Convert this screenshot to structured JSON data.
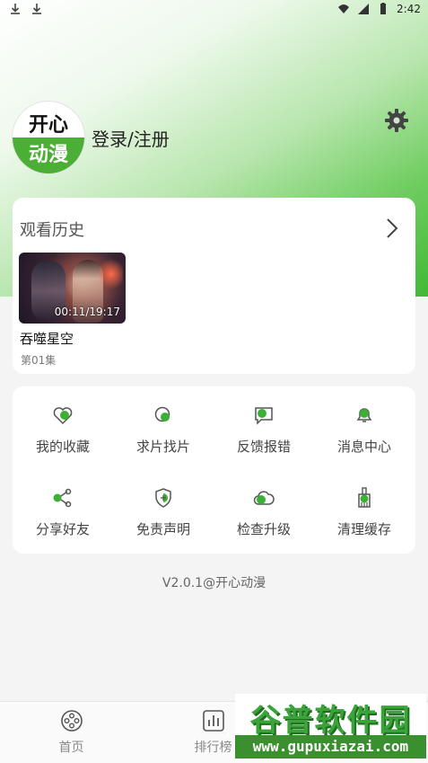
{
  "status_bar": {
    "time": "2:42",
    "left_icons": [
      "download-icon",
      "download-icon"
    ],
    "right_icons": [
      "wifi-icon",
      "signal-icon",
      "battery-icon"
    ]
  },
  "profile": {
    "avatar_text_top": "开心",
    "avatar_text_bottom": "动漫",
    "login_label": "登录/注册",
    "settings_icon": "gear-icon"
  },
  "history": {
    "title": "观看历史",
    "items": [
      {
        "title": "吞噬星空",
        "episode": "第01集",
        "progress": "00:11/19:17"
      }
    ]
  },
  "menu": {
    "items": [
      {
        "label": "我的收藏",
        "icon": "heart-icon"
      },
      {
        "label": "求片找片",
        "icon": "search-icon"
      },
      {
        "label": "反馈报错",
        "icon": "feedback-icon"
      },
      {
        "label": "消息中心",
        "icon": "bell-icon"
      },
      {
        "label": "分享好友",
        "icon": "share-icon"
      },
      {
        "label": "免责声明",
        "icon": "shield-icon"
      },
      {
        "label": "检查升级",
        "icon": "cloud-upgrade-icon"
      },
      {
        "label": "清理缓存",
        "icon": "broom-icon"
      }
    ]
  },
  "version_text": "V2.0.1@开心动漫",
  "tabbar": {
    "tabs": [
      {
        "label": "首页",
        "icon": "film-reel-icon"
      },
      {
        "label": "排行榜",
        "icon": "chart-icon"
      }
    ]
  },
  "watermark": {
    "top": "谷普软件园",
    "bottom": "www.gupuxiazai.com"
  },
  "colors": {
    "accent": "#4caf35",
    "background": "#f4f4f4"
  }
}
